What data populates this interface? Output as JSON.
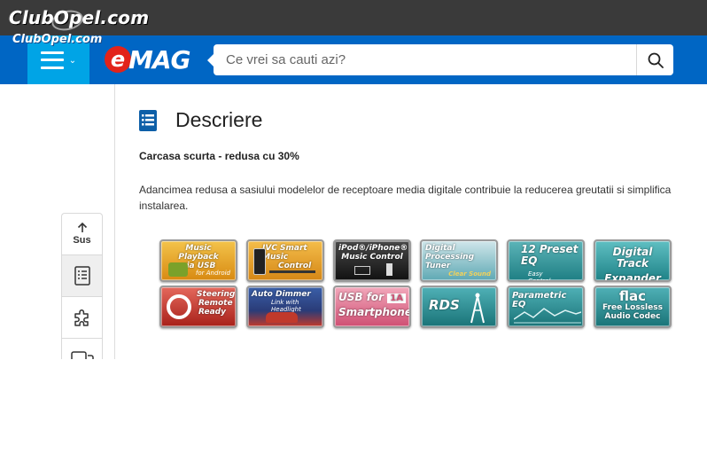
{
  "watermark": {
    "brand": "ClubOpel.com",
    "brand_small": "ClubOpel.com"
  },
  "header": {
    "logo_letter": "e",
    "logo_text": "MAG",
    "search_placeholder": "Ce vrei sa cauti azi?"
  },
  "side_nav": {
    "top_label": "Sus",
    "items": [
      "document-icon",
      "puzzle-icon",
      "chat-icon"
    ]
  },
  "section": {
    "title": "Descriere",
    "subtitle": "Carcasa scurta - redusa cu 30%",
    "description": "Adancimea redusa a sasiului modelelor de receptoare media digitale contribuie la reducerea greutatii si simplifica instalarea."
  },
  "badges": [
    {
      "line1": "Music Playback",
      "line2": "via USB",
      "sub": "for Android",
      "color": "#e6a21c"
    },
    {
      "line1": "JVC Smart Music",
      "line2": "Control",
      "sub": "",
      "color": "#e8a020"
    },
    {
      "line1": "iPod®/iPhone®",
      "line2": "Music Control",
      "sub": "",
      "color": "#2a2a2a"
    },
    {
      "line1": "Digital",
      "line2": "Processing",
      "line3": "Tuner",
      "sub": "Clear Sound",
      "color": "#4a9ea8"
    },
    {
      "line1": "12 Preset EQ",
      "line2": "",
      "sub": "Easy Control, Great Sound",
      "color": "#2f8f93"
    },
    {
      "line1": "Digital Track",
      "line2": "Expander",
      "sub": "",
      "color": "#2f9a9e"
    },
    {
      "line1": "Steering",
      "line2": "Remote",
      "line3": "Ready",
      "sub": "",
      "color": "#c23327"
    },
    {
      "line1": "Auto Dimmer",
      "line2": "",
      "sub": "Link with Headlight",
      "color": "#c5433a"
    },
    {
      "line1": "USB for",
      "line2": "Smartphone",
      "tag": "1A",
      "sub": "",
      "color": "#d9607e"
    },
    {
      "line1": "RDS",
      "line2": "",
      "sub": "",
      "color": "#2f8f93"
    },
    {
      "line1": "Parametric EQ",
      "line2": "",
      "sub": "",
      "color": "#2f8f93"
    },
    {
      "line1": "flac",
      "line2": "Free Lossless",
      "line3": "Audio Codec",
      "sub": "",
      "color": "#2f8f93"
    }
  ]
}
